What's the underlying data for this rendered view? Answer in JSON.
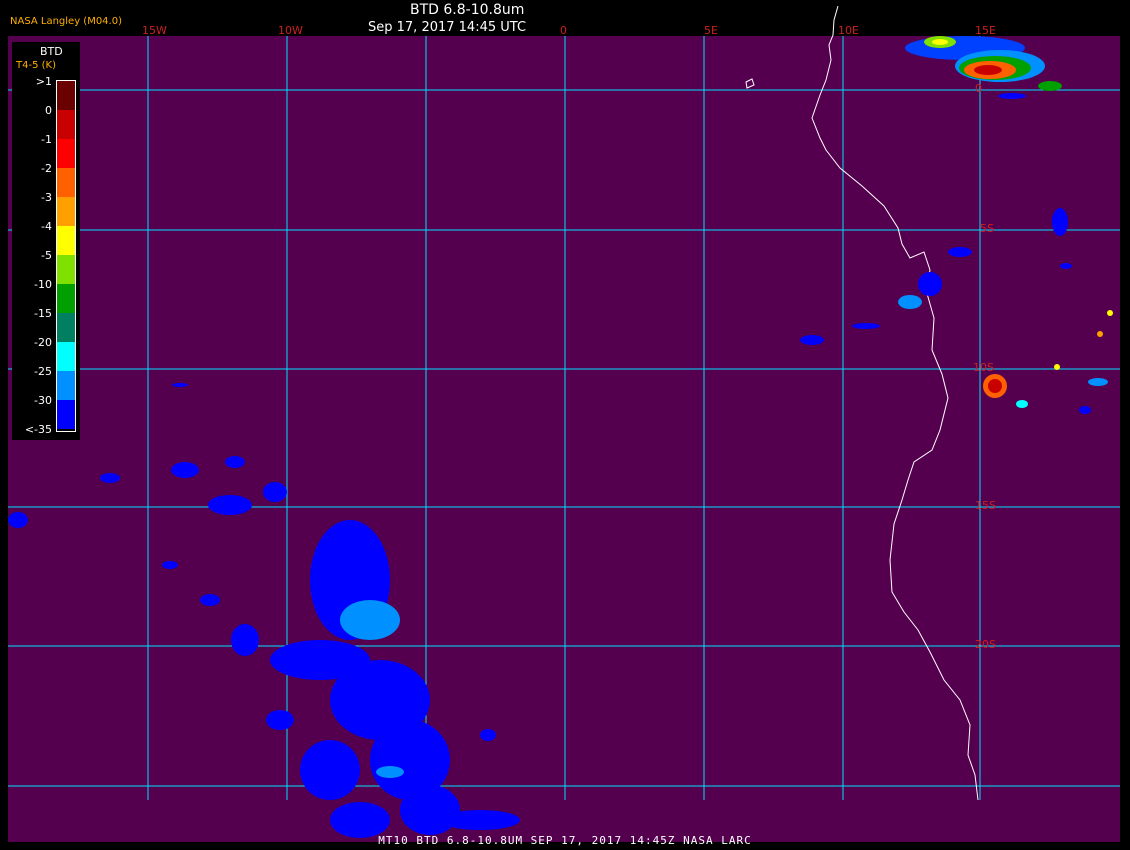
{
  "header": {
    "credit": "NASA Langley (M04.0)",
    "title": "BTD 6.8-10.8um",
    "datetime": "Sep 17, 2017 14:45 UTC"
  },
  "longitude_labels": [
    "15W",
    "10W",
    "0",
    "5E",
    "10E",
    "15E"
  ],
  "latitude_labels": [
    "0",
    "5S",
    "10S",
    "15S",
    "20S"
  ],
  "legend": {
    "title": "BTD",
    "subtitle": "T4-5 (K)",
    "ticks": [
      ">1",
      "0",
      "-1",
      "-2",
      "-3",
      "-4",
      "-5",
      "-10",
      "-15",
      "-20",
      "-25",
      "-30",
      "<-35"
    ],
    "colors": [
      "#6a0000",
      "#c80000",
      "#ff0000",
      "#ff6000",
      "#ffa000",
      "#ffff00",
      "#80e000",
      "#00a000",
      "#008060",
      "#00ffff",
      "#0090ff",
      "#0000ff",
      "#55004f"
    ]
  },
  "footer": "MT10  BTD 6.8-10.8UM  SEP 17, 2017 14:45Z  NASA LARC",
  "colors": {
    "background": "#55004f",
    "grid": "#00e0ff",
    "coast": "#ffffff",
    "label_red": "#cc2020"
  }
}
